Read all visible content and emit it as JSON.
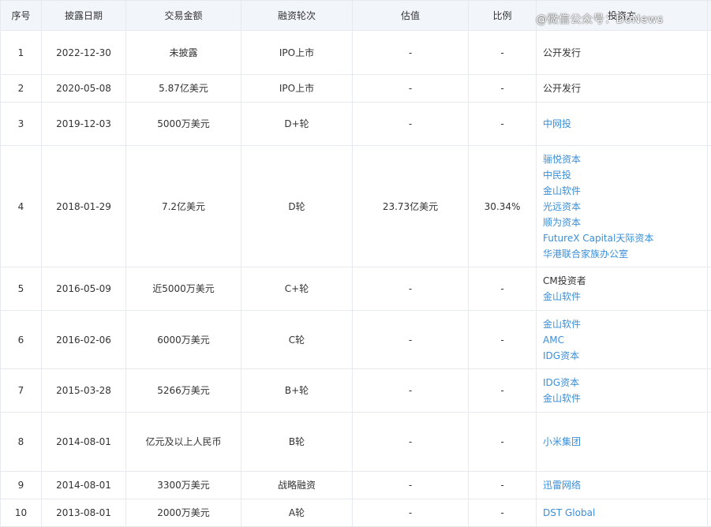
{
  "headers": [
    "序号",
    "披露日期",
    "交易金额",
    "融资轮次",
    "估值",
    "比例",
    "投资方"
  ],
  "watermark": "@微信公众号：DoNews",
  "rows": [
    {
      "no": "1",
      "date": "2022-12-30",
      "amount": "未披露",
      "round": "IPO上市",
      "valuation": "-",
      "ratio": "-",
      "investors": [
        {
          "name": "公开发行",
          "link": false
        }
      ]
    },
    {
      "no": "2",
      "date": "2020-05-08",
      "amount": "5.87亿美元",
      "round": "IPO上市",
      "valuation": "-",
      "ratio": "-",
      "investors": [
        {
          "name": "公开发行",
          "link": false
        }
      ]
    },
    {
      "no": "3",
      "date": "2019-12-03",
      "amount": "5000万美元",
      "round": "D+轮",
      "valuation": "-",
      "ratio": "-",
      "investors": [
        {
          "name": "中网投",
          "link": true
        }
      ]
    },
    {
      "no": "4",
      "date": "2018-01-29",
      "amount": "7.2亿美元",
      "round": "D轮",
      "valuation": "23.73亿美元",
      "ratio": "30.34%",
      "investors": [
        {
          "name": "骊悦资本",
          "link": true
        },
        {
          "name": "中民投",
          "link": true
        },
        {
          "name": "金山软件",
          "link": true
        },
        {
          "name": "光远资本",
          "link": true
        },
        {
          "name": "顺为资本",
          "link": true
        },
        {
          "name": "FutureX Capital天际资本",
          "link": true
        },
        {
          "name": "华港联合家族办公室",
          "link": true
        }
      ]
    },
    {
      "no": "5",
      "date": "2016-05-09",
      "amount": "近5000万美元",
      "round": "C+轮",
      "valuation": "-",
      "ratio": "-",
      "investors": [
        {
          "name": "CM投资者",
          "link": false
        },
        {
          "name": "金山软件",
          "link": true
        }
      ]
    },
    {
      "no": "6",
      "date": "2016-02-06",
      "amount": "6000万美元",
      "round": "C轮",
      "valuation": "-",
      "ratio": "-",
      "investors": [
        {
          "name": "金山软件",
          "link": true
        },
        {
          "name": "AMC",
          "link": true
        },
        {
          "name": "IDG资本",
          "link": true
        }
      ]
    },
    {
      "no": "7",
      "date": "2015-03-28",
      "amount": "5266万美元",
      "round": "B+轮",
      "valuation": "-",
      "ratio": "-",
      "investors": [
        {
          "name": "IDG资本",
          "link": true
        },
        {
          "name": "金山软件",
          "link": true
        }
      ]
    },
    {
      "no": "8",
      "date": "2014-08-01",
      "amount": "亿元及以上人民币",
      "round": "B轮",
      "valuation": "-",
      "ratio": "-",
      "investors": [
        {
          "name": "小米集团",
          "link": true
        }
      ]
    },
    {
      "no": "9",
      "date": "2014-08-01",
      "amount": "3300万美元",
      "round": "战略融资",
      "valuation": "-",
      "ratio": "-",
      "investors": [
        {
          "name": "迅雷网络",
          "link": true
        }
      ]
    },
    {
      "no": "10",
      "date": "2013-08-01",
      "amount": "2000万美元",
      "round": "A轮",
      "valuation": "-",
      "ratio": "-",
      "investors": [
        {
          "name": "DST Global",
          "link": true
        }
      ]
    }
  ]
}
